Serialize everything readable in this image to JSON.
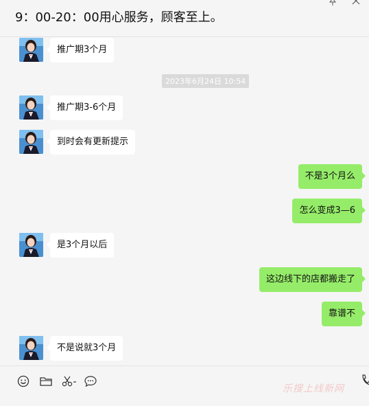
{
  "header": {
    "title": "9：00-20：00用心服务，顾客至上。",
    "icons": [
      "pin-icon",
      "close-icon"
    ]
  },
  "messages": [
    {
      "side": "left",
      "text": "推广期3个月"
    },
    {
      "side": "left",
      "text": "推广期3-6个月"
    },
    {
      "side": "left",
      "text": "到时会有更新提示"
    },
    {
      "side": "right",
      "text": "不是3个月么"
    },
    {
      "side": "right",
      "text": "怎么变成3—6"
    },
    {
      "side": "left",
      "text": "是3个月以后"
    },
    {
      "side": "right",
      "text": "这边线下的店都搬走了"
    },
    {
      "side": "right",
      "text": "靠谱不"
    },
    {
      "side": "left",
      "text": "不是说就3个月"
    }
  ],
  "timestamp": "2023年6月24日 10:54",
  "toolbar": {
    "icons": [
      "emoji-icon",
      "folder-icon",
      "scissors-icon",
      "chat-history-icon",
      "phone-icon"
    ]
  },
  "watermark": "乐搜上线新网",
  "colors": {
    "sent_bubble": "#95ec69",
    "received_bubble": "#ffffff",
    "background": "#f5f5f5"
  }
}
